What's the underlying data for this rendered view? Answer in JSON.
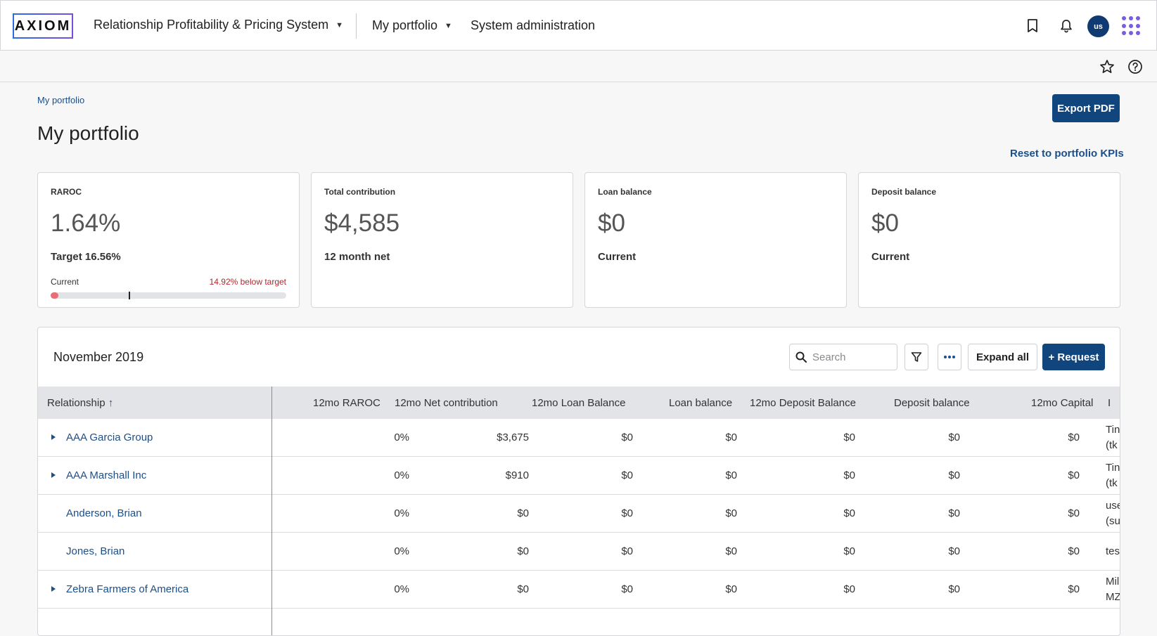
{
  "header": {
    "logo": "AXIOM",
    "app_title": "Relationship Profitability & Pricing System",
    "nav_portfolio": "My portfolio",
    "nav_admin": "System administration",
    "avatar_initials": "us"
  },
  "breadcrumb": "My portfolio",
  "page_title": "My portfolio",
  "export_label": "Export PDF",
  "reset_label": "Reset to portfolio KPIs",
  "kpis": {
    "raroc": {
      "label": "RAROC",
      "value": "1.64%",
      "sub": "Target 16.56%",
      "current_label": "Current",
      "below_text": "14.92% below target",
      "current_fraction": 0.0164,
      "target_fraction": 0.1656,
      "bar_color": "#e76e74"
    },
    "contribution": {
      "label": "Total contribution",
      "value": "$4,585",
      "sub": "12 month net"
    },
    "loan": {
      "label": "Loan balance",
      "value": "$0",
      "sub": "Current"
    },
    "deposit": {
      "label": "Deposit balance",
      "value": "$0",
      "sub": "Current"
    }
  },
  "table": {
    "period": "November 2019",
    "search_placeholder": "Search",
    "expand_all": "Expand all",
    "request": "+ Request",
    "columns": [
      "Relationship",
      "12mo RAROC",
      "12mo Net contribution",
      "12mo Loan Balance",
      "Loan balance",
      "12mo Deposit Balance",
      "Deposit balance",
      "12mo Capital",
      "I"
    ],
    "sort_arrow": "↑",
    "rows": [
      {
        "name": "AAA Garcia Group",
        "expandable": true,
        "raroc": "0%",
        "net": "$3,675",
        "loan12": "$0",
        "loan": "$0",
        "dep12": "$0",
        "dep": "$0",
        "cap": "$0",
        "extra1": "Tin",
        "extra2": "(tk"
      },
      {
        "name": "AAA Marshall Inc",
        "expandable": true,
        "raroc": "0%",
        "net": "$910",
        "loan12": "$0",
        "loan": "$0",
        "dep12": "$0",
        "dep": "$0",
        "cap": "$0",
        "extra1": "Tin",
        "extra2": "(tk"
      },
      {
        "name": "Anderson, Brian",
        "expandable": false,
        "raroc": "0%",
        "net": "$0",
        "loan12": "$0",
        "loan": "$0",
        "dep12": "$0",
        "dep": "$0",
        "cap": "$0",
        "extra1": "use",
        "extra2": "(su"
      },
      {
        "name": "Jones, Brian",
        "expandable": false,
        "raroc": "0%",
        "net": "$0",
        "loan12": "$0",
        "loan": "$0",
        "dep12": "$0",
        "dep": "$0",
        "cap": "$0",
        "extra1": "tes",
        "extra2": ""
      },
      {
        "name": "Zebra Farmers of America",
        "expandable": true,
        "raroc": "0%",
        "net": "$0",
        "loan12": "$0",
        "loan": "$0",
        "dep12": "$0",
        "dep": "$0",
        "cap": "$0",
        "extra1": "Mil",
        "extra2": "MZ"
      }
    ]
  }
}
